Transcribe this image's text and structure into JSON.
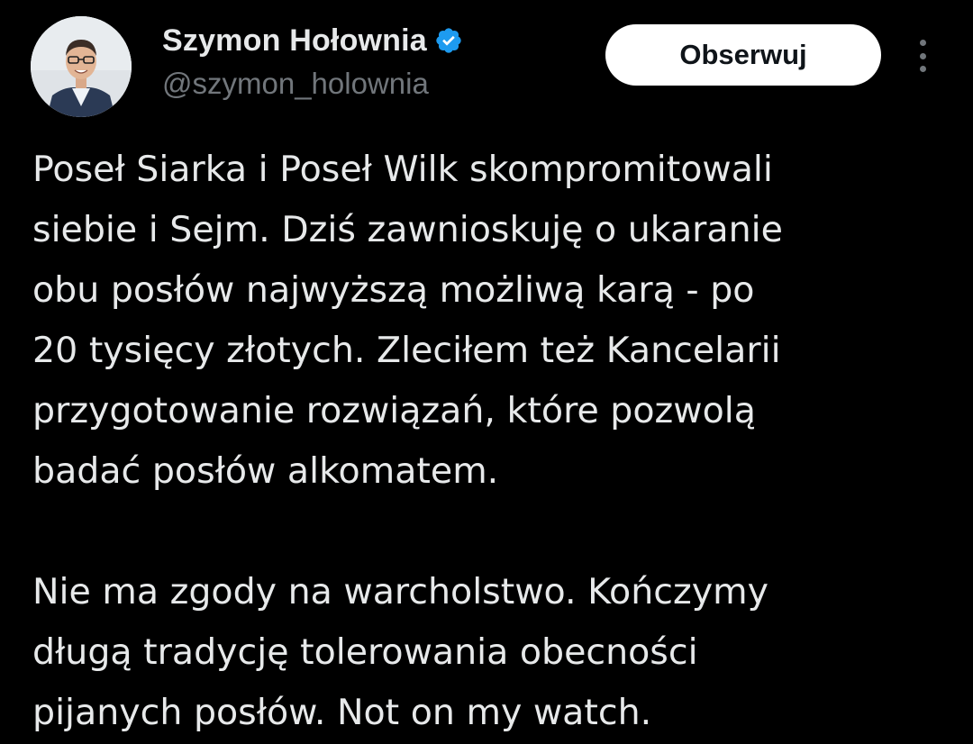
{
  "author": {
    "display_name": "Szymon Hołownia",
    "handle": "@szymon_holownia",
    "verified_icon": "verified-badge-icon",
    "verified_color": "#1d9bf0"
  },
  "actions": {
    "follow_label": "Obserwuj",
    "more_icon": "more-vertical-icon"
  },
  "tweet": {
    "paragraphs": [
      "Poseł Siarka i Poseł Wilk skompromitowali\nsiebie i Sejm. Dziś zawnioskuję o ukaranie\nobu posłów najwyższą możliwą karą - po\n20 tysięcy złotych. Zleciłem też Kancelarii\nprzygotowanie rozwiązań, które pozwolą\nbadać posłów alkomatem.",
      "Nie ma zgody na warcholstwo. Kończymy\ndługą tradycję tolerowania obecności\npijanych posłów. Not on my watch."
    ]
  },
  "colors": {
    "background": "#000000",
    "text_primary": "#e7e9ea",
    "text_secondary": "#71767b",
    "button_bg": "#ffffff",
    "button_text": "#0f1419"
  }
}
